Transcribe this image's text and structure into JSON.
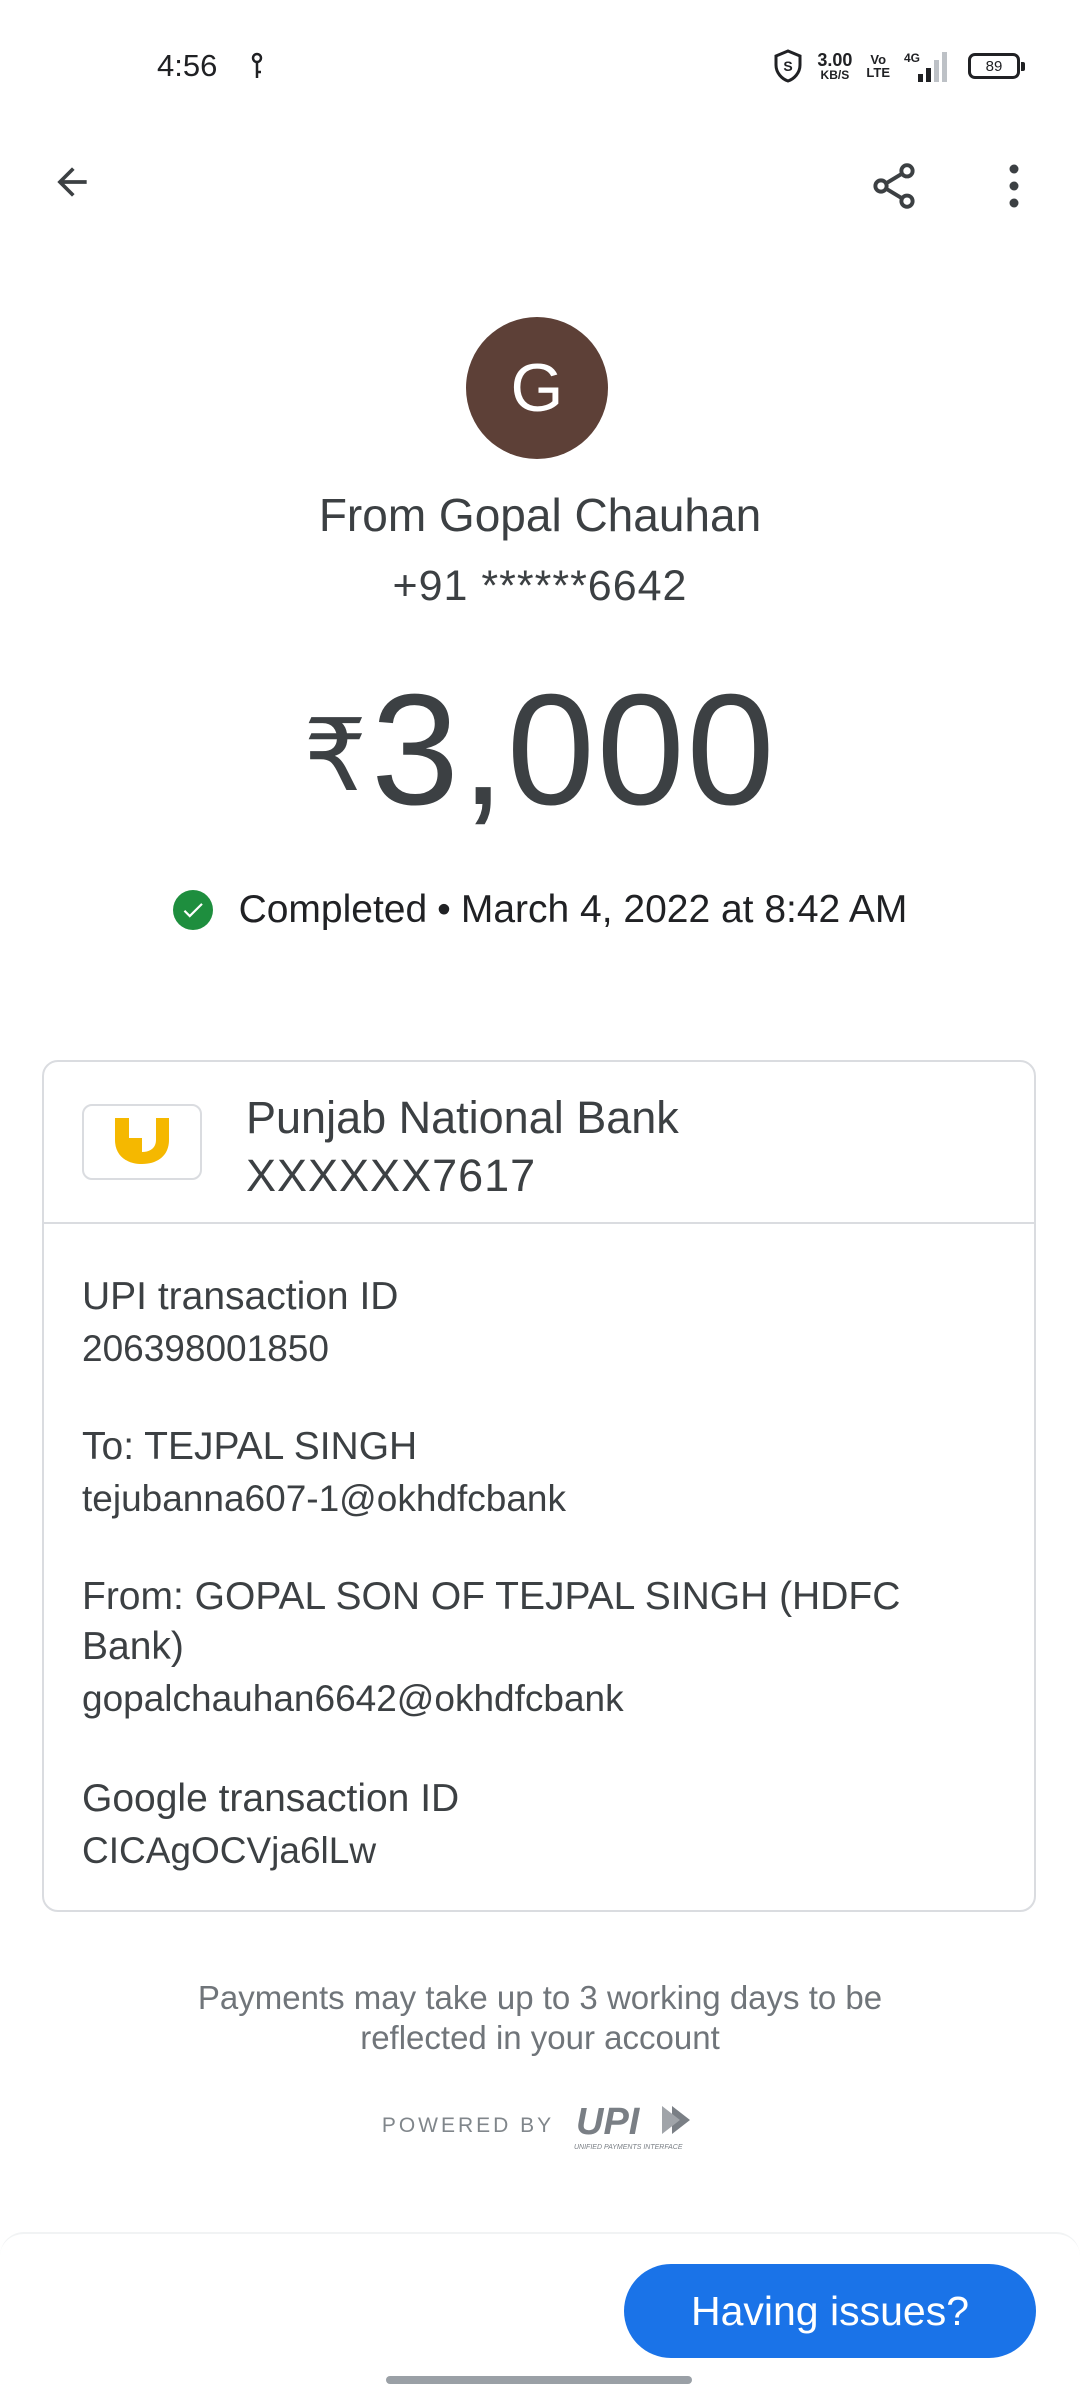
{
  "status_bar": {
    "time": "4:56",
    "net_speed_value": "3.00",
    "net_speed_unit": "KB/S",
    "volte_top": "Vo",
    "volte_bottom": "LTE",
    "network": "4G",
    "battery": "89"
  },
  "app_bar": {
    "back_icon": "arrow-back-icon",
    "share_icon": "share-icon",
    "more_icon": "more-vert-icon"
  },
  "header": {
    "avatar_initial": "G",
    "avatar_color": "#5d4037",
    "from_name": "From Gopal Chauhan",
    "phone": "+91 ******6642",
    "currency": "₹",
    "amount": "3,000",
    "status": "Completed",
    "separator": "•",
    "datetime": "March 4, 2022 at 8:42 AM",
    "status_color": "#1e8e3e"
  },
  "card": {
    "bank_name": "Punjab National Bank",
    "bank_account": "XXXXXX7617",
    "bank_logo_color": "#f5b800",
    "details": [
      {
        "label": "UPI transaction ID",
        "value": "206398001850"
      },
      {
        "label": "To: TEJPAL SINGH",
        "value": "tejubanna607-1@okhdfcbank"
      },
      {
        "label": "From: GOPAL SON OF TEJPAL SINGH (HDFC Bank)",
        "value": "gopalchauhan6642@okhdfcbank"
      },
      {
        "label": "Google transaction ID",
        "value": "CICAgOCVja6lLw"
      }
    ]
  },
  "footer": {
    "note_line1": "Payments may take up to 3 working days to be",
    "note_line2": "reflected in your account",
    "powered_by": "POWERED BY",
    "upi_text": "UPI",
    "upi_subtext": "UNIFIED PAYMENTS INTERFACE"
  },
  "actions": {
    "issues_button": "Having issues?",
    "accent_color": "#1a73e8"
  }
}
